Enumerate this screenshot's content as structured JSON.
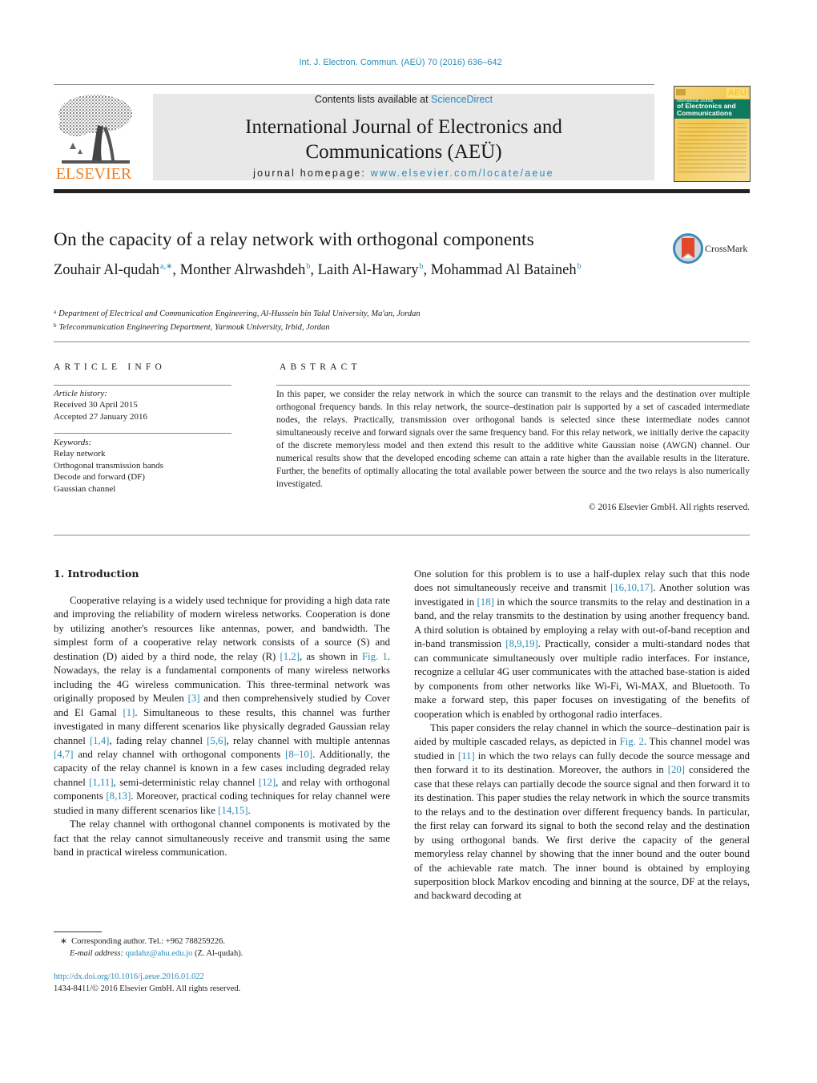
{
  "running_head": "Int. J. Electron. Commun. (AEÜ) 70 (2016) 636–642",
  "publisher": {
    "name": "ELSEVIER",
    "logo_icon": "elsevier-tree-icon",
    "brand_color": "#f07d1e"
  },
  "banner": {
    "contents_prefix": "Contents lists available at ",
    "contents_link": "ScienceDirect",
    "journal_title_line1": "International Journal of Electronics and",
    "journal_title_line2": "Communications (AEÜ)",
    "homepage_prefix": "journal homepage: ",
    "homepage_link": "www.elsevier.com/locate/aeue",
    "background": "#e8e8e9",
    "link_color": "#2a8ab8"
  },
  "cover": {
    "badge": "AEÜ",
    "line1": "International Journal",
    "line2a": "of Electronics and",
    "line2b": "Communications"
  },
  "article": {
    "title": "On the capacity of a relay network with orthogonal components",
    "crossmark_label": "CrossMark",
    "authors": [
      {
        "name": "Zouhair Al-qudah",
        "sup": "a,∗",
        "sep": ", "
      },
      {
        "name": "Monther Alrwashdeh",
        "sup": "b",
        "sep": ", "
      },
      {
        "name": "Laith Al-Hawary",
        "sup": "b",
        "sep": ", "
      },
      {
        "name": "Mohammad Al Bataineh",
        "sup": "b",
        "sep": ""
      }
    ],
    "affiliations": [
      {
        "key": "a",
        "text": "Department of Electrical and Communication Engineering, Al-Hussein bin Talal University, Ma'an, Jordan"
      },
      {
        "key": "b",
        "text": "Telecommunication Engineering Department, Yarmouk University, Irbid, Jordan"
      }
    ]
  },
  "article_info": {
    "heading": "ARTICLE INFO",
    "history_label": "Article history:",
    "received": "Received 30 April 2015",
    "accepted": "Accepted 27 January 2016",
    "keywords_label": "Keywords:",
    "keywords": [
      "Relay network",
      "Orthogonal transmission bands",
      "Decode and forward (DF)",
      "Gaussian channel"
    ]
  },
  "abstract": {
    "heading": "ABSTRACT",
    "text": "In this paper, we consider the relay network in which the source can transmit to the relays and the destination over multiple orthogonal frequency bands. In this relay network, the source–destination pair is supported by a set of cascaded intermediate nodes, the relays. Practically, transmission over orthogonal bands is selected since these intermediate nodes cannot simultaneously receive and forward signals over the same frequency band. For this relay network, we initially derive the capacity of the discrete memoryless model and then extend this result to the additive white Gaussian noise (AWGN) channel. Our numerical results show that the developed encoding scheme can attain a rate higher than the available results in the literature. Further, the benefits of optimally allocating the total available power between the source and the two relays is also numerically investigated.",
    "copyright": "© 2016 Elsevier GmbH. All rights reserved."
  },
  "intro": {
    "heading": "1.  Introduction",
    "left_paragraphs": [
      {
        "indent": true,
        "parts": [
          {
            "t": "Cooperative relaying is a widely used technique for providing a high data rate and improving the reliability of modern wireless networks. Cooperation is done by utilizing another's resources like antennas, power, and bandwidth. The simplest form of a cooperative relay network consists of a source (S) and destination (D) aided by a third node, the relay (R) "
          },
          {
            "t": "[1,2]",
            "link": true
          },
          {
            "t": ", as shown in "
          },
          {
            "t": "Fig. 1",
            "link": true
          },
          {
            "t": ". Nowadays, the relay is a fundamental components of many wireless networks including the 4G wireless communication. This three-terminal network was originally proposed by Meulen "
          },
          {
            "t": "[3]",
            "link": true
          },
          {
            "t": " and then comprehensively studied by Cover and El Gamal "
          },
          {
            "t": "[1]",
            "link": true
          },
          {
            "t": ". Simultaneous to these results, this channel was further investigated in many different scenarios like physically degraded Gaussian relay channel "
          },
          {
            "t": "[1,4]",
            "link": true
          },
          {
            "t": ", fading relay channel "
          },
          {
            "t": "[5,6]",
            "link": true
          },
          {
            "t": ", relay channel with multiple antennas "
          },
          {
            "t": "[4,7]",
            "link": true
          },
          {
            "t": " and relay channel with orthogonal components "
          },
          {
            "t": "[8–10]",
            "link": true
          },
          {
            "t": ". Additionally, the capacity of the relay channel is known in a few cases including degraded relay channel "
          },
          {
            "t": "[1,11]",
            "link": true
          },
          {
            "t": ", semi-deterministic relay channel "
          },
          {
            "t": "[12]",
            "link": true
          },
          {
            "t": ", and relay with orthogonal components "
          },
          {
            "t": "[8,13]",
            "link": true
          },
          {
            "t": ". Moreover, practical coding techniques for relay channel were studied in many different scenarios like "
          },
          {
            "t": "[14,15]",
            "link": true
          },
          {
            "t": "."
          }
        ]
      },
      {
        "indent": true,
        "parts": [
          {
            "t": "The relay channel with orthogonal channel components is motivated by the fact that the relay cannot simultaneously receive and transmit using the same band in practical wireless communication."
          }
        ]
      }
    ],
    "right_paragraphs": [
      {
        "indent": false,
        "parts": [
          {
            "t": "One solution for this problem is to use a half-duplex relay such that this node does not simultaneously receive and transmit "
          },
          {
            "t": "[16,10,17]",
            "link": true
          },
          {
            "t": ". Another solution was investigated in "
          },
          {
            "t": "[18]",
            "link": true
          },
          {
            "t": " in which the source transmits to the relay and destination in a band, and the relay transmits to the destination by using another frequency band. A third solution is obtained by employing a relay with out-of-band reception and in-band transmission "
          },
          {
            "t": "[8,9,19]",
            "link": true
          },
          {
            "t": ". Practically, consider a multi-standard nodes that can communicate simultaneously over multiple radio interfaces. For instance, recognize a cellular 4G user communicates with the attached base-station is aided by components from other networks like Wi-Fi, Wi-MAX, and Bluetooth. To make a forward step, this paper focuses on investigating of the benefits of cooperation which is enabled by orthogonal radio interfaces."
          }
        ]
      },
      {
        "indent": true,
        "parts": [
          {
            "t": "This paper considers the relay channel in which the source–destination pair is aided by multiple cascaded relays, as depicted in "
          },
          {
            "t": "Fig. 2",
            "link": true
          },
          {
            "t": ". This channel model was studied in "
          },
          {
            "t": "[11]",
            "link": true
          },
          {
            "t": " in which the two relays can fully decode the source message and then forward it to its destination. Moreover, the authors in "
          },
          {
            "t": "[20]",
            "link": true
          },
          {
            "t": " considered the case that these relays can partially decode the source signal and then forward it to its destination. This paper studies the relay network in which the source transmits to the relays and to the destination over different frequency bands. In particular, the first relay can forward its signal to both the second relay and the destination by using orthogonal bands. We first derive the capacity of the general memoryless relay channel by showing that the inner bound and the outer bound of the achievable rate match. The inner bound is obtained by employing superposition block Markov encoding and binning at the source, DF at the relays, and backward decoding at"
          }
        ]
      }
    ]
  },
  "footnotes": {
    "star": "∗",
    "corresponding": "Corresponding author. Tel.: +962 788259226.",
    "email_label": "E-mail address: ",
    "email": "qudahz@ahu.edu.jo",
    "email_suffix": " (Z. Al-qudah).",
    "doi": "http://dx.doi.org/10.1016/j.aeue.2016.01.022",
    "issn_line": "1434-8411/© 2016 Elsevier GmbH. All rights reserved."
  }
}
